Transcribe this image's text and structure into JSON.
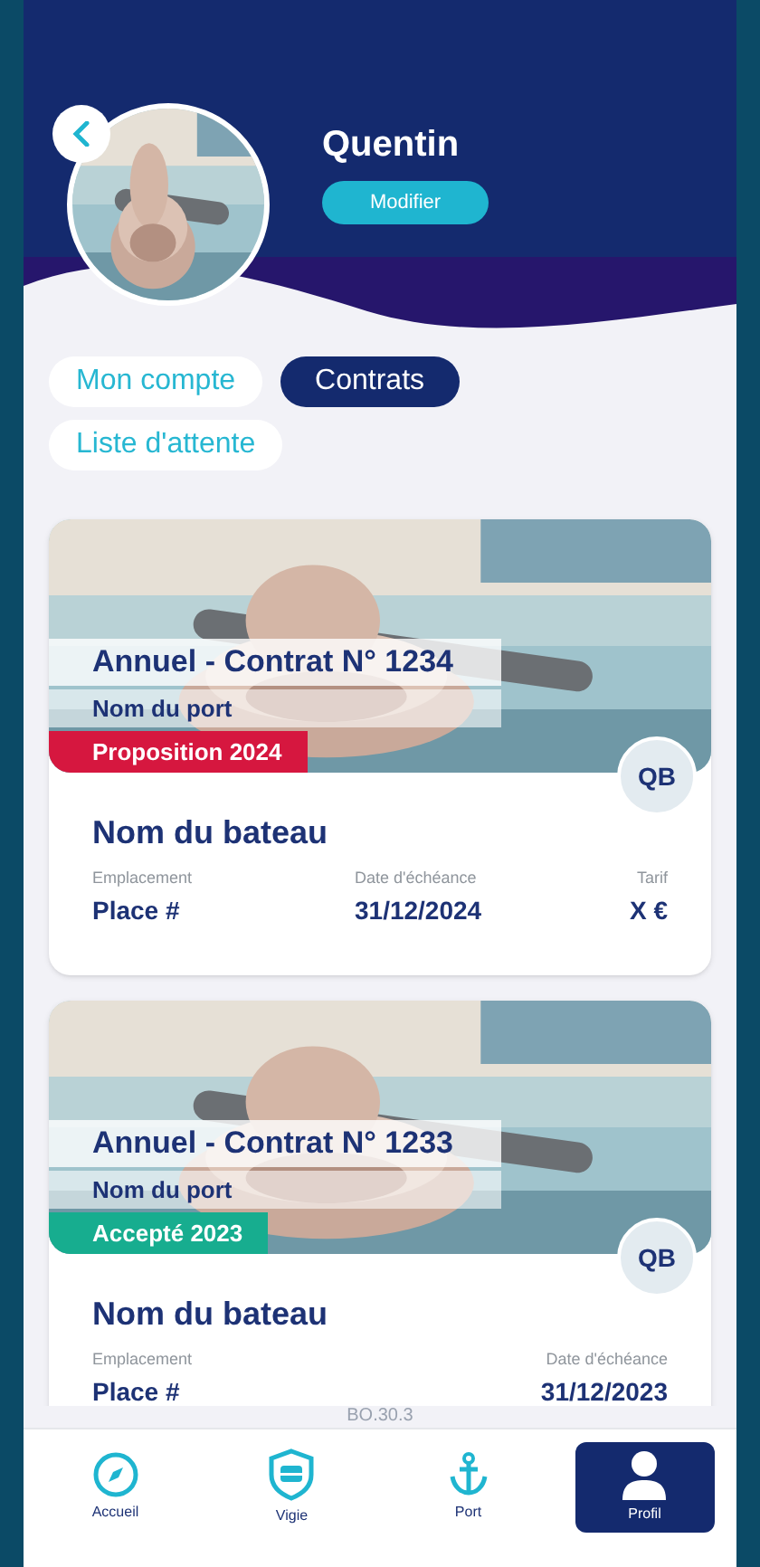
{
  "profile": {
    "name": "Quentin",
    "edit_button": "Modifier"
  },
  "tabs": [
    {
      "label": "Mon compte",
      "selected": false
    },
    {
      "label": "Contrats",
      "selected": true
    },
    {
      "label": "Liste d'attente",
      "selected": false
    }
  ],
  "contracts": [
    {
      "title": "Annuel - Contrat N° 1234",
      "port": "Nom du port",
      "status": {
        "label": "Proposition 2024",
        "color": "#d6173f"
      },
      "initials": "QB",
      "boat": "Nom du bateau",
      "fields": [
        {
          "label": "Emplacement",
          "value": "Place #"
        },
        {
          "label": "Date d'échéance",
          "value": "31/12/2024"
        },
        {
          "label": "Tarif",
          "value": "X €"
        }
      ]
    },
    {
      "title": "Annuel - Contrat N° 1233",
      "port": "Nom du port",
      "status": {
        "label": "Accepté 2023",
        "color": "#17ad8f"
      },
      "initials": "QB",
      "boat": "Nom du bateau",
      "fields": [
        {
          "label": "Emplacement",
          "value": "Place #"
        },
        {
          "label": "Date d'échéance",
          "value": "31/12/2023"
        }
      ]
    }
  ],
  "version": "BO.30.3",
  "nav": [
    {
      "kind": "compass",
      "label": "Accueil",
      "selected": false
    },
    {
      "kind": "shield",
      "label": "Vigie",
      "selected": false
    },
    {
      "kind": "anchor",
      "label": "Port",
      "selected": false
    },
    {
      "kind": "person",
      "label": "Profil",
      "selected": true
    }
  ]
}
